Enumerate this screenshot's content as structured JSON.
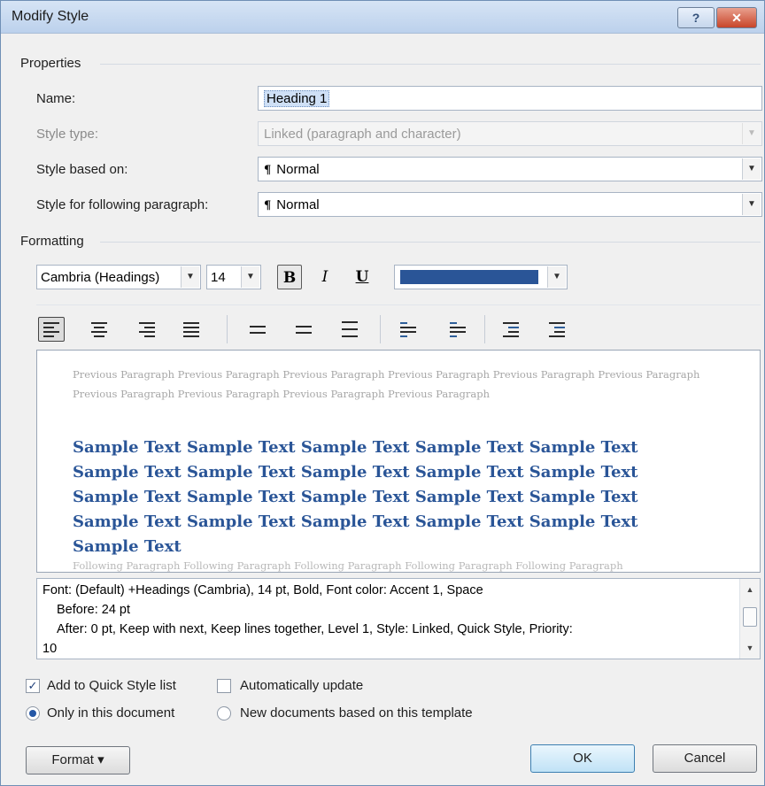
{
  "window": {
    "title": "Modify Style",
    "help_label": "?",
    "close_label": "✕"
  },
  "properties": {
    "section_label": "Properties",
    "name_label": "Name:",
    "name_value": "Heading 1",
    "style_type_label": "Style type:",
    "style_type_value": "Linked (paragraph and character)",
    "based_on_label": "Style based on:",
    "based_on_value": "Normal",
    "following_label": "Style for following paragraph:",
    "following_value": "Normal"
  },
  "formatting": {
    "section_label": "Formatting",
    "font": "Cambria (Headings)",
    "size": "14",
    "bold_label": "B",
    "italic_label": "I",
    "underline_label": "U",
    "font_color": "#2a5597"
  },
  "preview": {
    "previous_paragraph": "Previous Paragraph Previous Paragraph Previous Paragraph Previous Paragraph Previous Paragraph Previous Paragraph Previous Paragraph Previous Paragraph Previous Paragraph Previous Paragraph",
    "sample_text": "Sample Text Sample Text Sample Text Sample Text Sample Text Sample Text Sample Text Sample Text Sample Text Sample Text Sample Text Sample Text Sample Text Sample Text Sample Text Sample Text Sample Text Sample Text Sample Text Sample Text Sample Text",
    "following_paragraph": "Following Paragraph Following Paragraph Following Paragraph Following Paragraph Following Paragraph"
  },
  "description": {
    "line1": "Font: (Default) +Headings (Cambria), 14 pt, Bold, Font color: Accent 1, Space",
    "line2": "Before:  24 pt",
    "line3": "After:  0 pt, Keep with next, Keep lines together, Level 1, Style: Linked, Quick Style, Priority:",
    "line4": "10"
  },
  "options": {
    "add_quick_style_label": "Add to Quick Style list",
    "add_quick_style_checked": true,
    "auto_update_label": "Automatically update",
    "auto_update_checked": false,
    "only_this_doc_label": "Only in this document",
    "new_docs_label": "New documents based on this template",
    "selected_scope": "Only in this document"
  },
  "buttons": {
    "format_label": "Format ▾",
    "ok_label": "OK",
    "cancel_label": "Cancel"
  }
}
